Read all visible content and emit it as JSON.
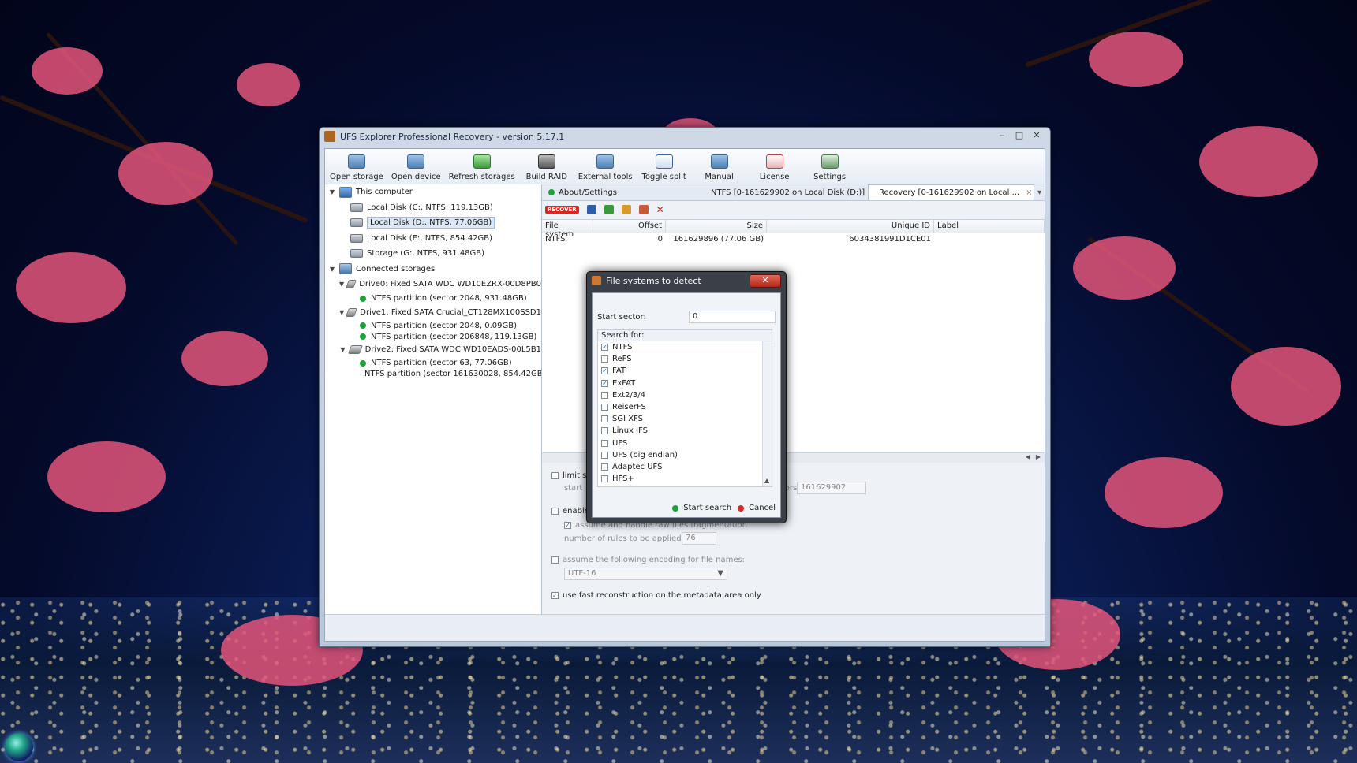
{
  "window": {
    "title": "UFS Explorer Professional Recovery - version 5.17.1",
    "controls": [
      "‒",
      "□",
      "✕"
    ]
  },
  "toolbar": [
    {
      "label": "Open storage",
      "icon": "open-storage-icon"
    },
    {
      "label": "Open device",
      "icon": "open-device-icon"
    },
    {
      "label": "Refresh storages",
      "icon": "refresh-icon"
    },
    {
      "label": "Build RAID",
      "icon": "raid-icon"
    },
    {
      "label": "External tools",
      "icon": "tools-icon"
    },
    {
      "label": "Toggle split",
      "icon": "split-icon"
    },
    {
      "label": "Manual",
      "icon": "manual-icon"
    },
    {
      "label": "License",
      "icon": "license-icon"
    },
    {
      "label": "Settings",
      "icon": "settings-icon"
    }
  ],
  "tree": {
    "this_computer": "This computer",
    "local_disks": [
      "Local Disk (C:, NTFS, 119.13GB)",
      "Local Disk (D:, NTFS, 77.06GB)",
      "Local Disk (E:, NTFS, 854.42GB)",
      "Storage (G:, NTFS, 931.48GB)"
    ],
    "connected": "Connected storages",
    "drives": [
      {
        "name": "Drive0: Fixed SATA WDC WD10EZRX-00D8PB0",
        "partitions": [
          "NTFS partition (sector 2048, 931.48GB)"
        ]
      },
      {
        "name": "Drive1: Fixed SATA Crucial_CT128MX100SSD1",
        "partitions": [
          "NTFS partition (sector 2048, 0.09GB)",
          "NTFS partition (sector 206848, 119.13GB)"
        ]
      },
      {
        "name": "Drive2: Fixed SATA WDC WD10EADS-00L5B1",
        "partitions": [
          "NTFS partition (sector 63, 77.06GB)",
          "NTFS partition (sector 161630028, 854.42GB)"
        ]
      }
    ]
  },
  "tabs": [
    {
      "label": "About/Settings"
    },
    {
      "label": "NTFS [0-161629902 on Local Disk (D:)]"
    },
    {
      "label": "Recovery [0-161629902 on Local ...",
      "close": "×"
    }
  ],
  "tabs_menu": "▾",
  "recover_label": "RECOVER",
  "table": {
    "headers": [
      "File system",
      "Offset",
      "Size",
      "Unique ID",
      "Label"
    ],
    "rows": [
      [
        "NTFS",
        "0",
        "161629896 (77.06 GB)",
        "6034381991D1CE01",
        ""
      ]
    ]
  },
  "options": {
    "limit_scan": "limit sc",
    "start_label": "start",
    "sectors_label": "sectors:",
    "sectors_value": "161629902",
    "enable": "enable",
    "fragmentation": "assume and handle raw files fragmentation",
    "rules_label": "number of rules to be applied:",
    "rules_value": "76",
    "encoding_label": "assume the following encoding for file names:",
    "encoding_value": "UTF-16",
    "fast_reconstruction": "use fast reconstruction on the metadata area only"
  },
  "dialog": {
    "title": "File systems to detect",
    "close": "✕",
    "start_sector_label": "Start sector:",
    "start_sector_value": "0",
    "search_for_label": "Search for:",
    "filesystems": [
      {
        "name": "NTFS",
        "checked": true
      },
      {
        "name": "ReFS",
        "checked": false
      },
      {
        "name": "FAT",
        "checked": true
      },
      {
        "name": "ExFAT",
        "checked": true
      },
      {
        "name": "Ext2/3/4",
        "checked": false
      },
      {
        "name": "ReiserFS",
        "checked": false
      },
      {
        "name": "SGI XFS",
        "checked": false
      },
      {
        "name": "Linux JFS",
        "checked": false
      },
      {
        "name": "UFS",
        "checked": false
      },
      {
        "name": "UFS (big endian)",
        "checked": false
      },
      {
        "name": "Adaptec UFS",
        "checked": false
      },
      {
        "name": "HFS+",
        "checked": false
      }
    ],
    "start_search": "Start search",
    "cancel": "Cancel"
  },
  "colors": {
    "status_green": "#1ba338",
    "cancel_red": "#d62a24",
    "recover_red": "#d42a1f"
  }
}
